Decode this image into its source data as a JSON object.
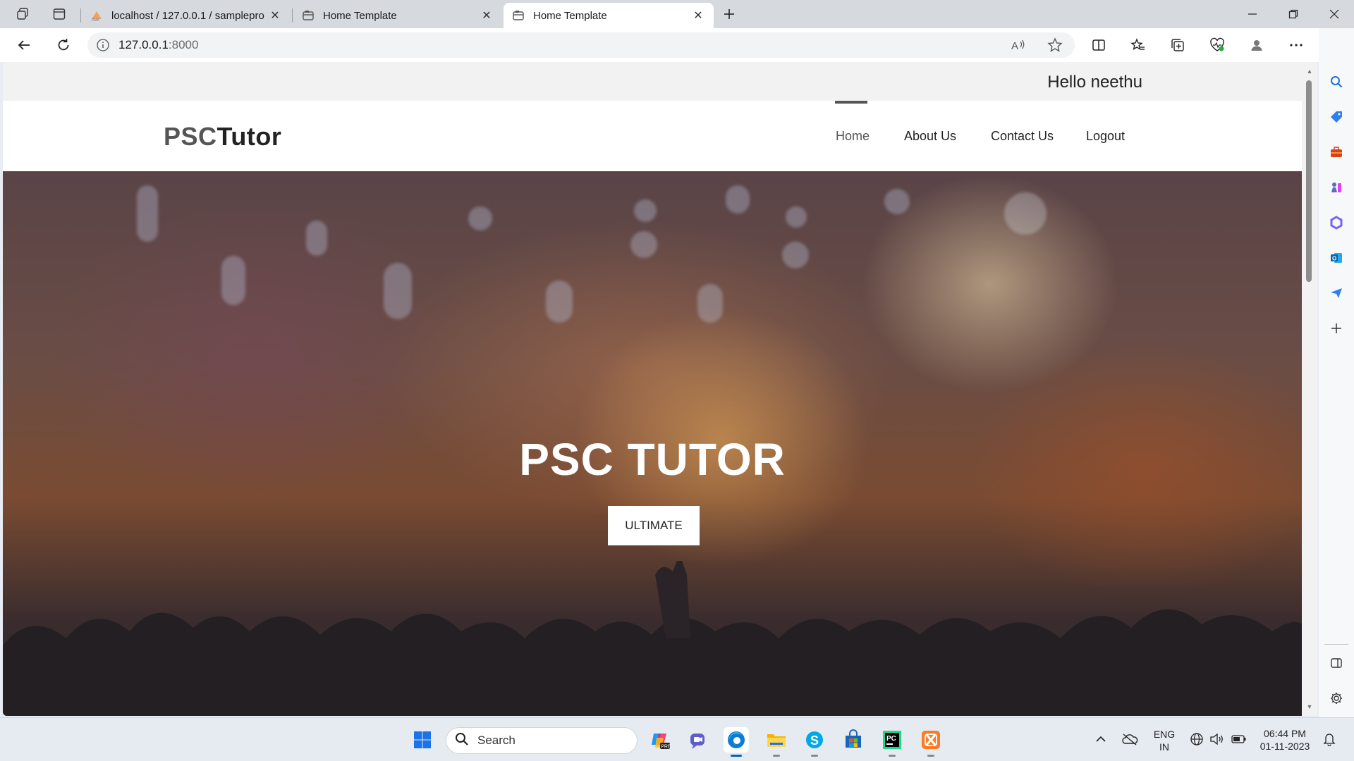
{
  "browser": {
    "tabs": [
      {
        "title": "localhost / 127.0.0.1 / samplepro",
        "icon": "phpmyadmin-icon",
        "active": false
      },
      {
        "title": "Home Template",
        "icon": "page-icon",
        "active": false
      },
      {
        "title": "Home Template",
        "icon": "page-icon",
        "active": true
      }
    ],
    "address": {
      "host": "127.0.0.1",
      "port": ":8000"
    }
  },
  "page": {
    "greeting": "Hello neethu",
    "logo": {
      "part1": "PSC",
      "part2": "Tutor"
    },
    "nav": [
      {
        "label": "Home",
        "active": true
      },
      {
        "label": "About Us",
        "active": false
      },
      {
        "label": "Contact Us",
        "active": false
      },
      {
        "label": "Logout",
        "active": false
      }
    ],
    "hero": {
      "title": "PSC TUTOR",
      "button": "ULTIMATE"
    }
  },
  "taskbar": {
    "search_placeholder": "Search",
    "language": {
      "line1": "ENG",
      "line2": "IN"
    },
    "clock": {
      "time": "06:44 PM",
      "date": "01-11-2023"
    }
  },
  "colors": {
    "edge_accent": "#0067c0",
    "nav_active": "#555555",
    "hero_text": "#ffffff"
  }
}
